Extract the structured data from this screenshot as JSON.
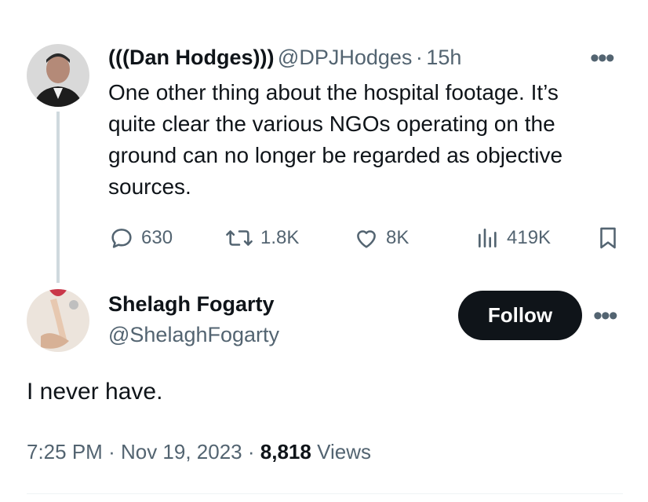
{
  "parent_tweet": {
    "display_name": "(((Dan Hodges)))",
    "handle": "@DPJHodges",
    "separator": "·",
    "time_ago": "15h",
    "text_lines": [
      "One other thing about the hospital footage. It’s",
      "quite clear the various NGOs operating on the",
      "ground can no longer be regarded as objective",
      "sources."
    ],
    "replies": "630",
    "reposts": "1.8K",
    "likes": "8K",
    "views": "419K"
  },
  "main_tweet": {
    "display_name": "Shelagh Fogarty",
    "handle": "@ShelaghFogarty",
    "follow_label": "Follow",
    "text": "I never have.",
    "time": "7:25 PM",
    "sep1": "·",
    "date": "Nov 19, 2023",
    "sep2": "·",
    "views_count": "8,818",
    "views_label": "Views"
  },
  "icons": {
    "reply": "reply-icon",
    "repost": "repost-icon",
    "like": "like-icon",
    "views": "views-icon",
    "bookmark": "bookmark-icon",
    "more": "more-icon"
  },
  "colors": {
    "text": "#0f1419",
    "muted": "#536471",
    "follow_bg": "#0f1419"
  }
}
